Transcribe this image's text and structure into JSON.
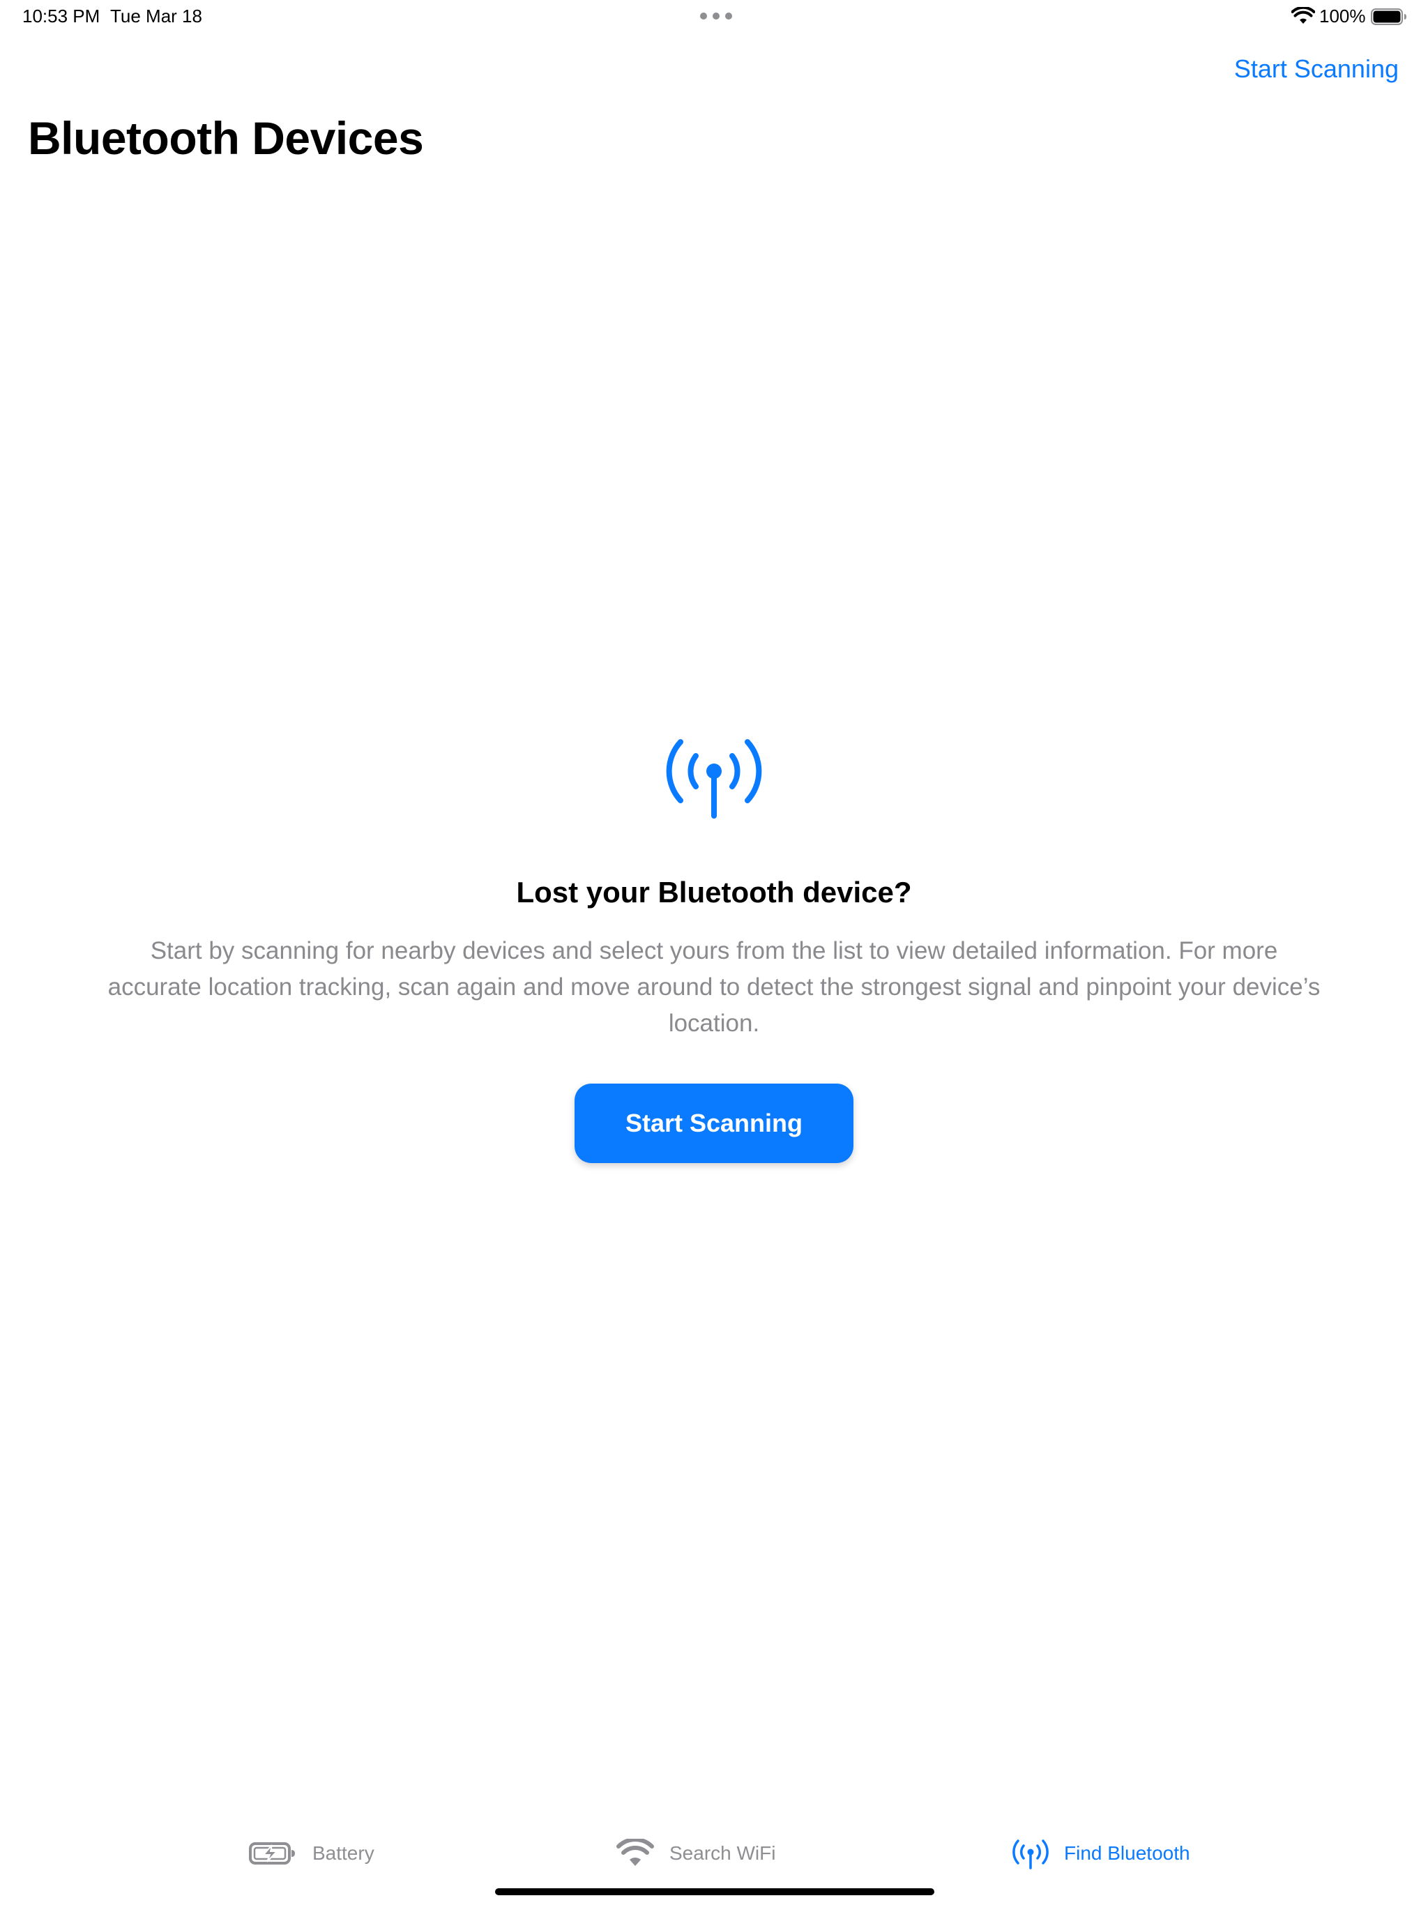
{
  "status_bar": {
    "time": "10:53 PM",
    "date": "Tue Mar 18",
    "battery_percent": "100%",
    "battery_level": 1.0
  },
  "nav": {
    "action_label": "Start Scanning",
    "title": "Bluetooth Devices"
  },
  "empty_state": {
    "icon": "antenna-radiowaves-icon",
    "title": "Lost your Bluetooth device?",
    "description": "Start by scanning for nearby devices and select yours from the list to view detailed information. For more accurate location tracking, scan again and move around to detect the strongest signal and pinpoint your device’s location.",
    "button_label": "Start Scanning"
  },
  "tabs": [
    {
      "label": "Battery",
      "icon": "battery-charging-icon",
      "active": false
    },
    {
      "label": "Search WiFi",
      "icon": "wifi-icon",
      "active": false
    },
    {
      "label": "Find Bluetooth",
      "icon": "antenna-radiowaves-icon",
      "active": true
    }
  ],
  "colors": {
    "accent": "#0a7aff",
    "secondary_text": "#8a8a8e",
    "inactive_tab": "#8e8e93"
  }
}
